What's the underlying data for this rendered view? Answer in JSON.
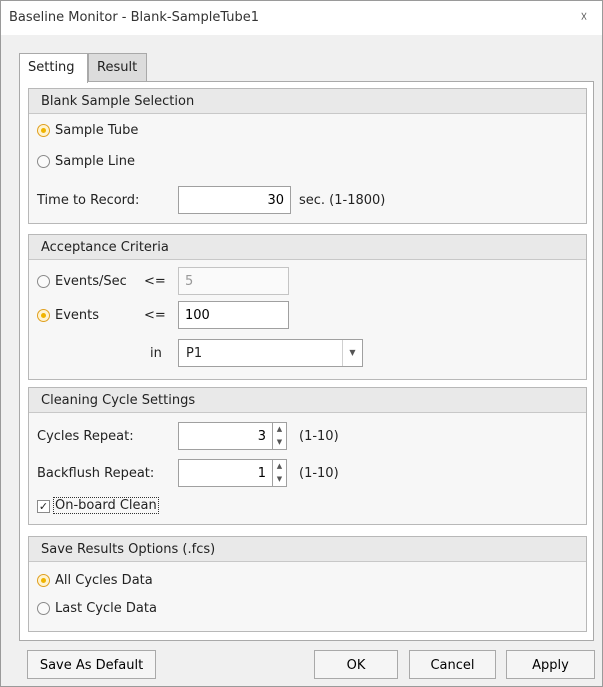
{
  "window": {
    "title": "Baseline Monitor - Blank-SampleTube1",
    "close_glyph": "☓"
  },
  "tabs": [
    {
      "label": "Setting"
    },
    {
      "label": "Result"
    }
  ],
  "blank_sample": {
    "heading": "Blank Sample Selection",
    "options": [
      {
        "label": "Sample Tube",
        "checked": true
      },
      {
        "label": "Sample Line",
        "checked": false
      }
    ],
    "time_label": "Time to Record:",
    "time_value": "30",
    "time_suffix": "sec. (1-1800)"
  },
  "acceptance": {
    "heading": "Acceptance Criteria",
    "events_sec_label": "Events/Sec",
    "events_sec_op": "<=",
    "events_sec_value": "5",
    "events_label": "Events",
    "events_op": "<=",
    "events_value": "100",
    "in_label": "in",
    "gate_value": "P1"
  },
  "cleaning": {
    "heading": "Cleaning Cycle Settings",
    "cycles_label": "Cycles Repeat:",
    "cycles_value": "3",
    "cycles_range": "(1-10)",
    "backflush_label": "Backflush Repeat:",
    "backflush_value": "1",
    "backflush_range": "(1-10)",
    "onboard_label": "On-board Clean",
    "onboard_checked": true
  },
  "save_results": {
    "heading": "Save Results Options (.fcs)",
    "all_label": "All Cycles Data",
    "last_label": "Last Cycle Data"
  },
  "footer": {
    "save_default": "Save As Default",
    "ok": "OK",
    "cancel": "Cancel",
    "apply": "Apply"
  },
  "colors": {
    "radio_accent": "#f0b400"
  }
}
